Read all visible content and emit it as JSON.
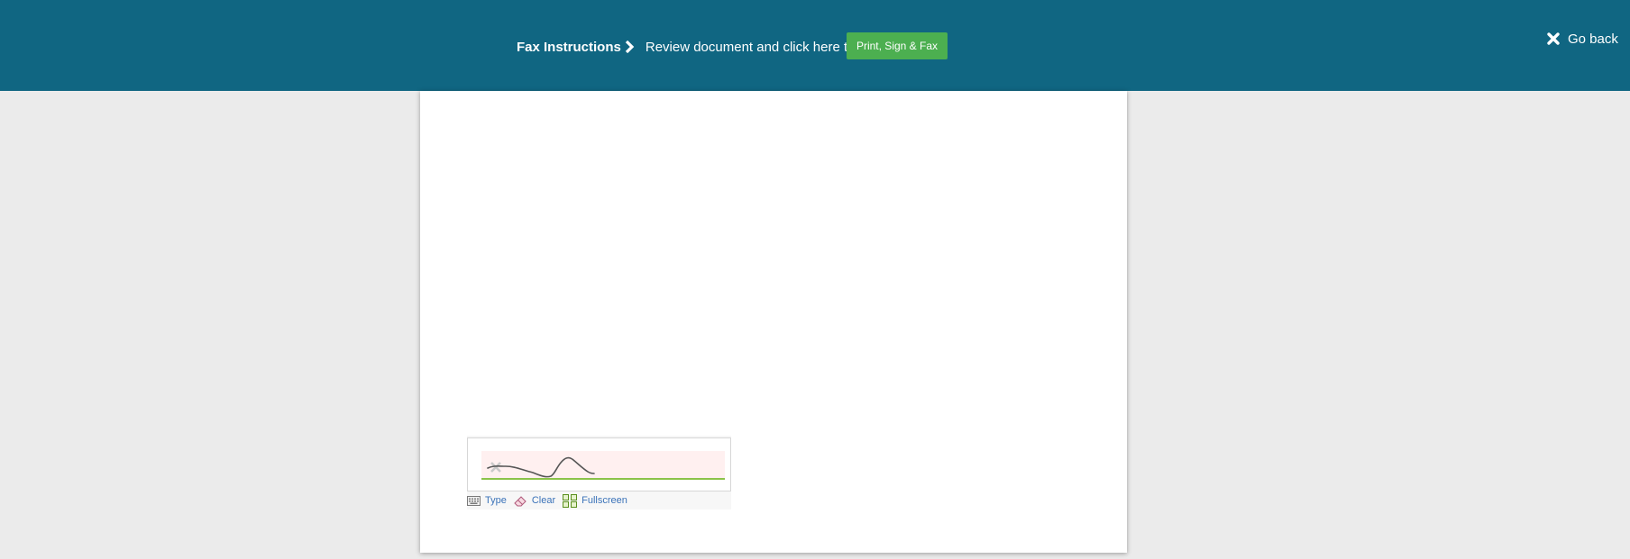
{
  "topbar": {
    "instructions_title": "Fax Instructions",
    "instructions_text": "Review document and click here to",
    "print_button_label": "Print, Sign & Fax",
    "go_back_label": "Go back",
    "background_color": "#106682",
    "button_color": "#4caf50"
  },
  "signature": {
    "tools": [
      {
        "icon": "keyboard-icon",
        "label": "Type"
      },
      {
        "icon": "eraser-icon",
        "label": "Clear"
      },
      {
        "icon": "fullscreen-icon",
        "label": "Fullscreen"
      }
    ],
    "baseline_color": "#8bc34a",
    "area_color": "#fff0f0"
  }
}
